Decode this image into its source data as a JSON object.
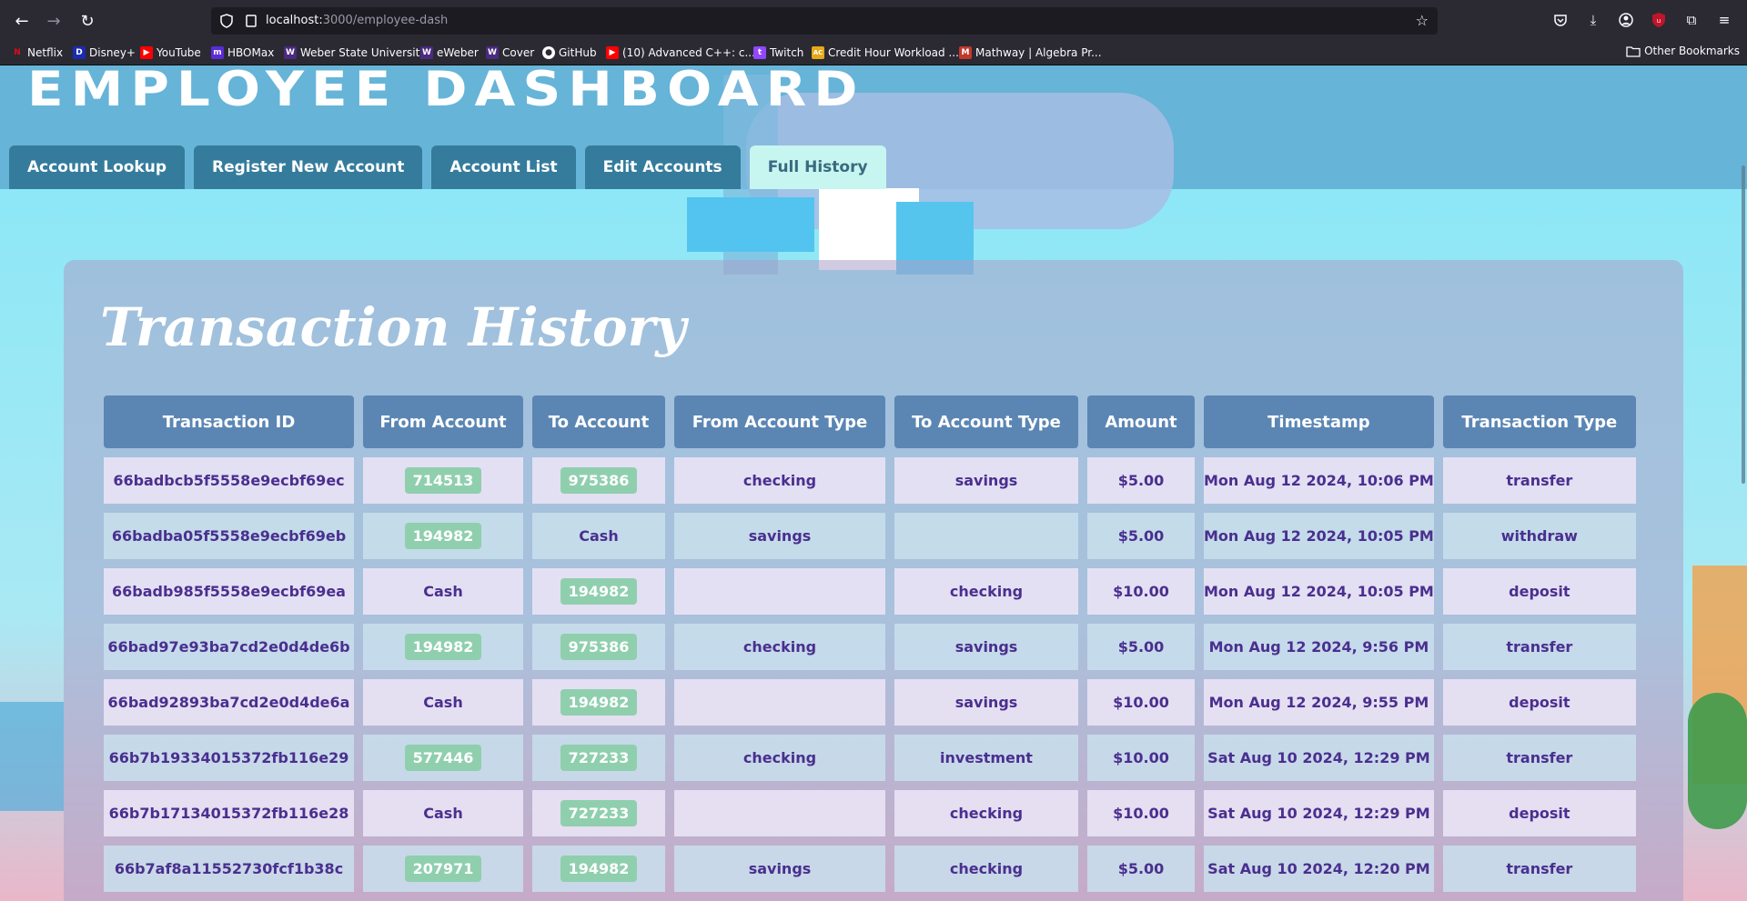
{
  "browser": {
    "url_host": "localhost:",
    "url_path": "3000/employee-dash",
    "bookmarks": [
      {
        "label": "Netflix",
        "color": "#e50914",
        "glyph": "N"
      },
      {
        "label": "Disney+",
        "color": "#1a2bb0",
        "glyph": "D"
      },
      {
        "label": "YouTube",
        "color": "#ff0000",
        "glyph": "▶"
      },
      {
        "label": "HBOMax",
        "color": "#5b2bd8",
        "glyph": "m"
      },
      {
        "label": "Weber State University",
        "color": "#4b2a80",
        "glyph": "W"
      },
      {
        "label": "eWeber",
        "color": "#4b2a80",
        "glyph": "W"
      },
      {
        "label": "Cover",
        "color": "#4b2a80",
        "glyph": "W"
      },
      {
        "label": "GitHub",
        "color": "#333333",
        "glyph": "●"
      },
      {
        "label": "(10) Advanced C++: c...",
        "color": "#ff0000",
        "glyph": "▶"
      },
      {
        "label": "Twitch",
        "color": "#9146ff",
        "glyph": "t"
      },
      {
        "label": "Credit Hour Workload ...",
        "color": "#e6a817",
        "glyph": "AC"
      },
      {
        "label": "Mathway | Algebra Pr...",
        "color": "#c0392b",
        "glyph": "M"
      }
    ],
    "other_bookmarks": "Other Bookmarks"
  },
  "header": {
    "title": "EMPLOYEE   DASHBOARD",
    "tabs": [
      {
        "label": "Account Lookup",
        "active": false
      },
      {
        "label": "Register New Account",
        "active": false
      },
      {
        "label": "Account List",
        "active": false
      },
      {
        "label": "Edit Accounts",
        "active": false
      },
      {
        "label": "Full History",
        "active": true
      }
    ]
  },
  "history": {
    "title": "Transaction History",
    "columns": [
      "Transaction ID",
      "From Account",
      "To Account",
      "From Account Type",
      "To Account Type",
      "Amount",
      "Timestamp",
      "Transaction Type"
    ],
    "rows": [
      {
        "id": "66badbcb5f5558e9ecbf69ec",
        "from": "714513",
        "to": "975386",
        "from_type": "checking",
        "to_type": "savings",
        "amount": "$5.00",
        "timestamp": "Mon Aug 12 2024, 10:06 PM",
        "type": "transfer"
      },
      {
        "id": "66badba05f5558e9ecbf69eb",
        "from": "194982",
        "to": "Cash",
        "from_type": "savings",
        "to_type": "",
        "amount": "$5.00",
        "timestamp": "Mon Aug 12 2024, 10:05 PM",
        "type": "withdraw"
      },
      {
        "id": "66badb985f5558e9ecbf69ea",
        "from": "Cash",
        "to": "194982",
        "from_type": "",
        "to_type": "checking",
        "amount": "$10.00",
        "timestamp": "Mon Aug 12 2024, 10:05 PM",
        "type": "deposit"
      },
      {
        "id": "66bad97e93ba7cd2e0d4de6b",
        "from": "194982",
        "to": "975386",
        "from_type": "checking",
        "to_type": "savings",
        "amount": "$5.00",
        "timestamp": "Mon Aug 12 2024, 9:56 PM",
        "type": "transfer"
      },
      {
        "id": "66bad92893ba7cd2e0d4de6a",
        "from": "Cash",
        "to": "194982",
        "from_type": "",
        "to_type": "savings",
        "amount": "$10.00",
        "timestamp": "Mon Aug 12 2024, 9:55 PM",
        "type": "deposit"
      },
      {
        "id": "66b7b19334015372fb116e29",
        "from": "577446",
        "to": "727233",
        "from_type": "checking",
        "to_type": "investment",
        "amount": "$10.00",
        "timestamp": "Sat Aug 10 2024, 12:29 PM",
        "type": "transfer"
      },
      {
        "id": "66b7b17134015372fb116e28",
        "from": "Cash",
        "to": "727233",
        "from_type": "",
        "to_type": "checking",
        "amount": "$10.00",
        "timestamp": "Sat Aug 10 2024, 12:29 PM",
        "type": "deposit"
      },
      {
        "id": "66b7af8a11552730fcf1b38c",
        "from": "207971",
        "to": "194982",
        "from_type": "savings",
        "to_type": "checking",
        "amount": "$5.00",
        "timestamp": "Sat Aug 10 2024, 12:20 PM",
        "type": "transfer"
      }
    ]
  }
}
